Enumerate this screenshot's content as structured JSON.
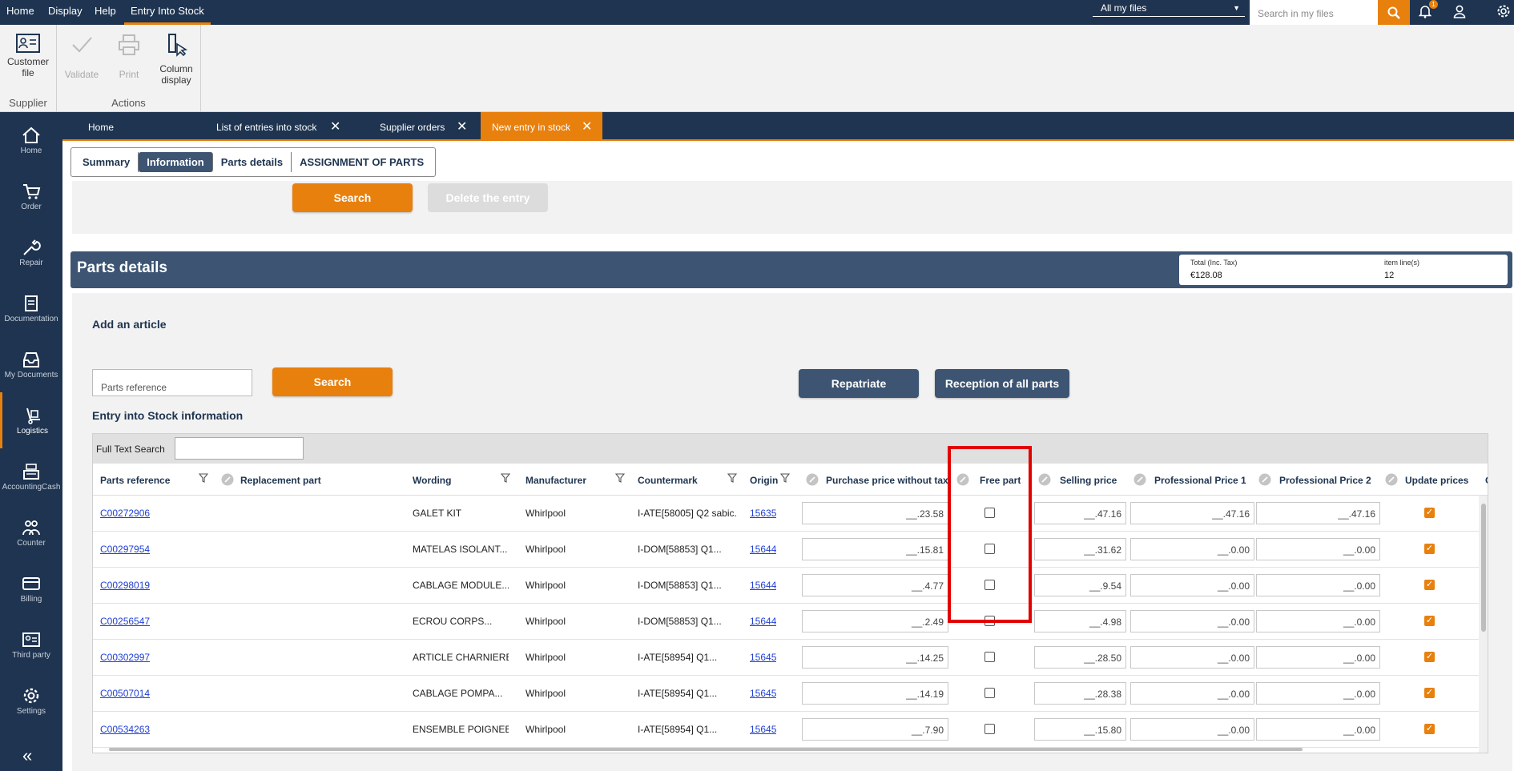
{
  "topbar": {
    "menu": [
      "Home",
      "Display",
      "Help",
      "Entry Into Stock"
    ],
    "files_select": "All my files",
    "search_placeholder": "Search in my files",
    "notification_count": "1"
  },
  "ribbon": {
    "supplier_group": "Supplier",
    "customer_file": "Customer file",
    "actions_group": "Actions",
    "validate": "Validate",
    "print": "Print",
    "column_display": "Column display"
  },
  "sidebar": [
    "Home",
    "Order",
    "Repair",
    "Documentation",
    "My Documents",
    "Logistics",
    "AccountingCash",
    "Counter",
    "Billing",
    "Third party",
    "Settings"
  ],
  "doc_tabs": [
    "Home",
    "List of entries into stock",
    "Supplier orders",
    "New entry in stock"
  ],
  "sub_tabs": [
    "Summary",
    "Information",
    "Parts details",
    "ASSIGNMENT OF PARTS"
  ],
  "search_panel": {
    "search": "Search",
    "delete": "Delete the entry"
  },
  "parts_details": {
    "title": "Parts details",
    "total_label": "Total (Inc. Tax)",
    "total_value": "€128.08",
    "items_label": "item line(s)",
    "items_value": "12",
    "add_article": "Add an article",
    "parts_ref_placeholder": "Parts reference",
    "search": "Search",
    "repatriate": "Repatriate",
    "reception_all": "Reception of all parts",
    "entry_info": "Entry into Stock information",
    "full_text_search": "Full Text Search"
  },
  "columns": [
    "Parts reference",
    "Replacement part",
    "Wording",
    "Manufacturer",
    "Countermark",
    "Origin",
    "Purchase price without tax",
    "Free part",
    "Selling price",
    "Professional Price 1",
    "Professional Price 2",
    "Update prices",
    "C"
  ],
  "rows": [
    {
      "ref": "C00272906",
      "wording": "GALET KIT",
      "manufacturer": "Whirlpool",
      "countermark": "I-ATE[58005] Q2 sabic...",
      "origin": "15635",
      "purchase": "__.23.58",
      "selling": "__.47.16",
      "pro1": "__.47.16",
      "pro2": "__.47.16"
    },
    {
      "ref": "C00297954",
      "wording": "MATELAS ISOLANT...",
      "manufacturer": "Whirlpool",
      "countermark": "I-DOM[58853] Q1...",
      "origin": "15644",
      "purchase": "__.15.81",
      "selling": "__.31.62",
      "pro1": "__.0.00",
      "pro2": "__.0.00"
    },
    {
      "ref": "C00298019",
      "wording": "CABLAGE MODULE...",
      "manufacturer": "Whirlpool",
      "countermark": "I-DOM[58853] Q1...",
      "origin": "15644",
      "purchase": "__.4.77",
      "selling": "__.9.54",
      "pro1": "__.0.00",
      "pro2": "__.0.00"
    },
    {
      "ref": "C00256547",
      "wording": "ECROU CORPS...",
      "manufacturer": "Whirlpool",
      "countermark": "I-DOM[58853] Q1...",
      "origin": "15644",
      "purchase": "__.2.49",
      "selling": "__.4.98",
      "pro1": "__.0.00",
      "pro2": "__.0.00"
    },
    {
      "ref": "C00302997",
      "wording": "ARTICLE CHARNIERE...",
      "manufacturer": "Whirlpool",
      "countermark": "I-ATE[58954] Q1...",
      "origin": "15645",
      "purchase": "__.14.25",
      "selling": "__.28.50",
      "pro1": "__.0.00",
      "pro2": "__.0.00"
    },
    {
      "ref": "C00507014",
      "wording": "CABLAGE POMPA...",
      "manufacturer": "Whirlpool",
      "countermark": "I-ATE[58954] Q1...",
      "origin": "15645",
      "purchase": "__.14.19",
      "selling": "__.28.38",
      "pro1": "__.0.00",
      "pro2": "__.0.00"
    },
    {
      "ref": "C00534263",
      "wording": "ENSEMBLE POIGNEE...",
      "manufacturer": "Whirlpool",
      "countermark": "I-ATE[58954] Q1...",
      "origin": "15645",
      "purchase": "__.7.90",
      "selling": "__.15.80",
      "pro1": "__.0.00",
      "pro2": "__.0.00"
    }
  ],
  "colors": {
    "navy": "#1e3450",
    "orange": "#e8800e",
    "slate": "#3d5573",
    "highlight": "#e20000"
  }
}
